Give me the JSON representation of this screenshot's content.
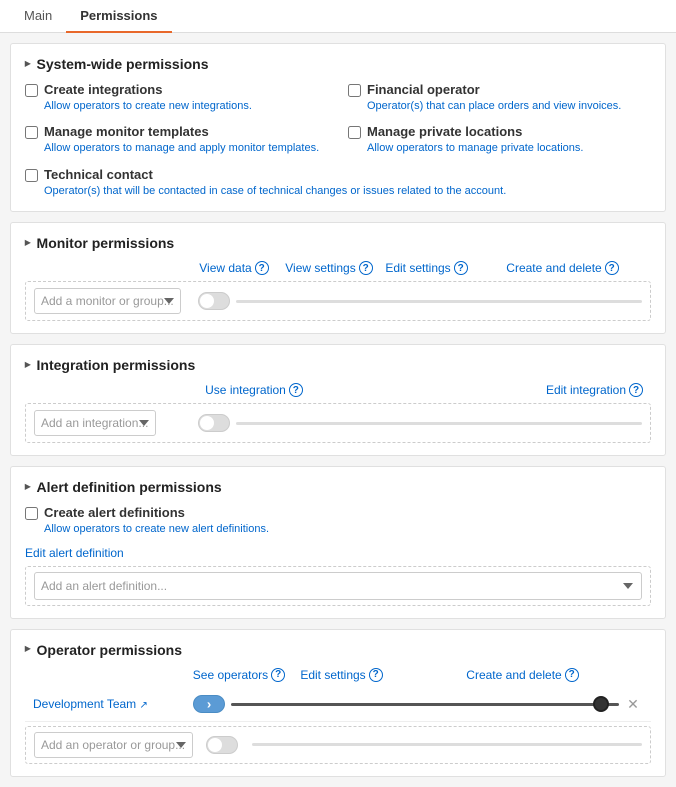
{
  "tabs": [
    {
      "label": "Main",
      "active": false
    },
    {
      "label": "Permissions",
      "active": true
    }
  ],
  "sections": {
    "system_wide": {
      "title": "System-wide permissions",
      "checkboxes": [
        {
          "label": "Create integrations",
          "desc": "Allow operators to create new integrations.",
          "checked": false,
          "full_width": false
        },
        {
          "label": "Financial operator",
          "desc": "Operator(s) that can place orders and view invoices.",
          "checked": false,
          "full_width": false
        },
        {
          "label": "Manage monitor templates",
          "desc": "Allow operators to manage and apply monitor templates.",
          "checked": false,
          "full_width": false
        },
        {
          "label": "Manage private locations",
          "desc": "Allow operators to manage private locations.",
          "checked": false,
          "full_width": false
        },
        {
          "label": "Technical contact",
          "desc": "Operator(s) that will be contacted in case of technical changes or issues related to the account.",
          "checked": false,
          "full_width": true
        }
      ]
    },
    "monitor": {
      "title": "Monitor permissions",
      "col_headers": [
        "View data",
        "View settings",
        "Edit settings",
        "Create and delete"
      ],
      "add_placeholder": "Add a monitor or group..."
    },
    "integration": {
      "title": "Integration permissions",
      "col_headers": [
        "Use integration",
        "Edit integration"
      ],
      "add_placeholder": "Add an integration..."
    },
    "alert": {
      "title": "Alert definition permissions",
      "create_label": "Create alert definitions",
      "create_desc": "Allow operators to create new alert definitions.",
      "edit_label": "Edit alert definition",
      "add_placeholder": "Add an alert definition..."
    },
    "operator": {
      "title": "Operator permissions",
      "col_headers": [
        "See operators",
        "Edit settings",
        "Create and delete"
      ],
      "rows": [
        {
          "name": "Development Team",
          "is_link": true
        }
      ],
      "add_placeholder": "Add an operator or group..."
    }
  }
}
